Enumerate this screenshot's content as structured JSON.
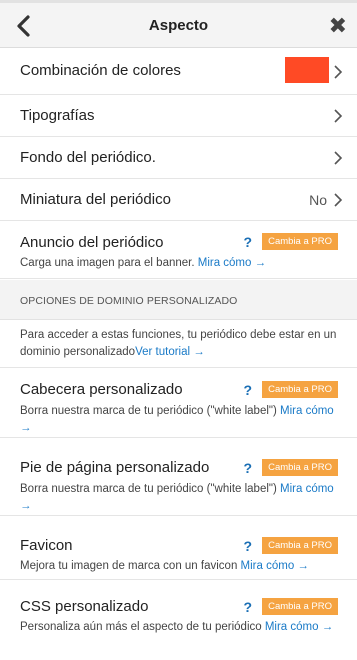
{
  "header": {
    "title": "Aspecto"
  },
  "rows": {
    "colors": {
      "label": "Combinación de colores",
      "swatch_color": "#ff4a25"
    },
    "fonts": {
      "label": "Tipografías"
    },
    "background": {
      "label": "Fondo del periódico."
    },
    "thumbnail": {
      "label": "Miniatura del periódico",
      "value": "No"
    }
  },
  "ad": {
    "label": "Anuncio del periódico",
    "help": "?",
    "badge": "Cambia a PRO",
    "desc": "Carga una imagen para el banner. ",
    "link": "Mira cómo →"
  },
  "section": {
    "title": "OPCIONES DE DOMINIO PERSONALIZADO",
    "info": "Para acceder a estas funciones, tu periódico debe estar en un dominio personalizado",
    "info_link": "Ver tutorial →"
  },
  "custom": [
    {
      "label": "Cabecera personalizado",
      "help": "?",
      "badge": "Cambia a PRO",
      "desc": "Borra nuestra marca de tu periódico (\"white label\") ",
      "link": "Mira cómo →"
    },
    {
      "label": "Pie de página personalizado",
      "help": "?",
      "badge": "Cambia a PRO",
      "desc": "Borra nuestra marca de tu periódico (\"white label\") ",
      "link": "Mira cómo →"
    },
    {
      "label": "Favicon",
      "help": "?",
      "badge": "Cambia a PRO",
      "desc": "Mejora tu imagen de marca con un favicon ",
      "link": "Mira cómo →"
    },
    {
      "label": "CSS personalizado",
      "help": "?",
      "badge": "Cambia a PRO",
      "desc": "Personaliza aún más el aspecto de tu periódico ",
      "link": "Mira cómo →"
    }
  ],
  "colors": {
    "accent_link": "#1a7ac7",
    "pro_badge": "#f5a341",
    "help": "#1a6fb5"
  },
  "icons": {
    "back": "chevron-left-icon",
    "close": "close-icon",
    "row": "chevron-right-icon"
  }
}
